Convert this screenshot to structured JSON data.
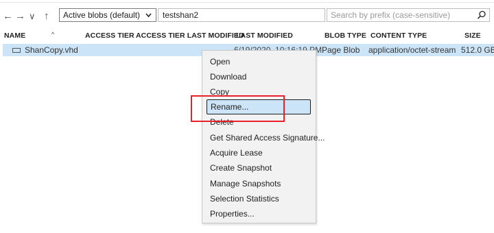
{
  "toolbar": {
    "back_glyph": "←",
    "forward_glyph": "→",
    "history_glyph": "∨",
    "up_glyph": "↑",
    "view_select": "Active blobs (default)",
    "path": "testshan2",
    "search_placeholder": "Search by prefix (case-sensitive)",
    "search_icon": "search-icon"
  },
  "columns": [
    "NAME",
    "ACCESS TIER",
    "ACCESS TIER LAST MODIFIED",
    "LAST MODIFIED",
    "BLOB TYPE",
    "CONTENT TYPE",
    "SIZE"
  ],
  "rows": [
    {
      "name": "ShanCopy.vhd",
      "access_tier": "",
      "access_tier_last_modified": "",
      "last_modified": "6/19/2020, 10:16:19 PM",
      "blob_type": "Page Blob",
      "content_type": "application/octet-stream",
      "size": "512.0 GB"
    }
  ],
  "context_menu": {
    "items": [
      "Open",
      "Download",
      "Copy",
      "Rename...",
      "Delete",
      "Get Shared Access Signature...",
      "Acquire Lease",
      "Create Snapshot",
      "Manage Snapshots",
      "Selection Statistics",
      "Properties..."
    ],
    "highlighted": "Rename..."
  },
  "colors": {
    "selection": "#cce4f7",
    "annotation": "#e8202a"
  }
}
